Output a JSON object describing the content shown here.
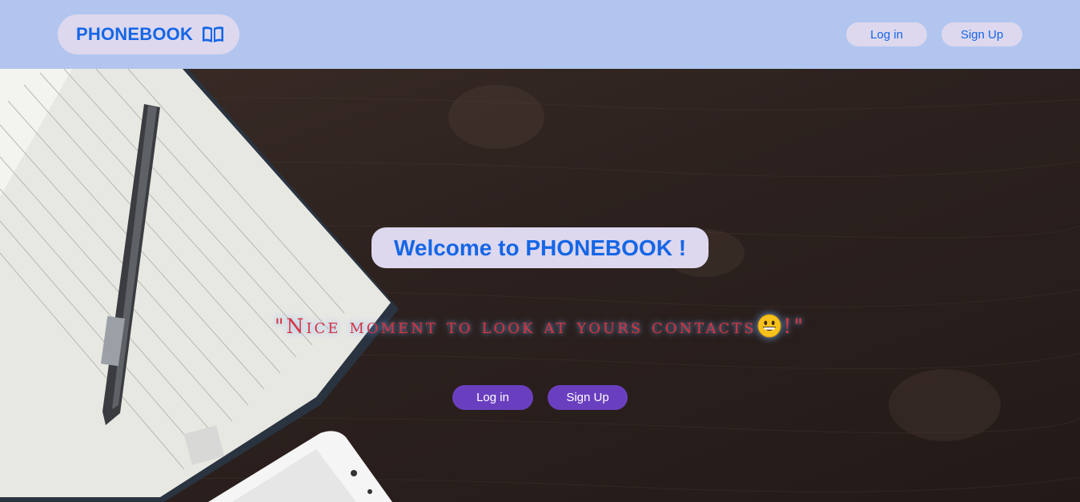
{
  "header": {
    "logo_text": "PHONEBOOK",
    "logo_icon": "open-book-icon",
    "nav": {
      "login_label": "Log in",
      "signup_label": "Sign Up"
    }
  },
  "hero": {
    "welcome_title": "Welcome to PHONEBOOK !",
    "quote_before": "\"Nice moment to look at yours contacts",
    "quote_emoji": "grinning-face-emoji",
    "quote_after": "!\"",
    "login_label": "Log in",
    "signup_label": "Sign Up"
  },
  "colors": {
    "header_bg": "#b1c5ee",
    "pill_bg": "#ddd8ee",
    "brand_blue": "#1566e6",
    "hero_button_bg": "#6a3fbf",
    "quote_red": "#d9333f"
  }
}
